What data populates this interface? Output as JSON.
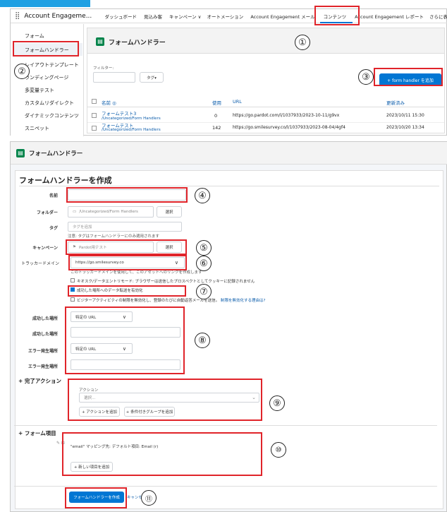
{
  "topbar": {
    "app_name": "Account Engageme...",
    "nav_items": [
      "ダッシュボード",
      "見込み客",
      "キャンペーン ∨",
      "オートメーション",
      "Account Engagement メール",
      "コンテンツ",
      "Account Engagement レポート",
      "さらに表"
    ]
  },
  "sidebar": {
    "items": [
      "フォーム",
      "フォームハンドラー",
      "レイアウトテンプレート",
      "ランディングページ",
      "多変量テスト",
      "カスタムリダイレクト",
      "ダイナミックコンテンツ",
      "スニペット"
    ]
  },
  "list_panel": {
    "title": "フォームハンドラー",
    "filter_label": "フィルター:",
    "tag_button": "タグ▾",
    "add_button": "+ form handler を追加",
    "columns": [
      "名前 ◎",
      "使用",
      "URL",
      "更新済み"
    ],
    "rows": [
      {
        "name": "フォームテスト3",
        "folder": "/Uncategorized/Form Handlers",
        "usage": "0",
        "url": "https://go.pardot.com/l/1037933/2023-10-11/g9vx",
        "updated": "2023/10/11 15:30"
      },
      {
        "name": "フォームテスト",
        "folder": "/Uncategorized/Form Handlers",
        "usage": "142",
        "url": "https://go.smilesurvey.co/l/1037933/2023-08-04/4gf4",
        "updated": "2023/10/20 13:34"
      }
    ]
  },
  "create_panel": {
    "header": "フォームハンドラー",
    "title": "フォームハンドラーを作成",
    "name_label": "名前",
    "folder_label": "フォルダー",
    "folder_value": "/Uncategorized/Form Handlers",
    "select_label": "選択",
    "tag_label": "タグ",
    "tag_placeholder": "タグを追加",
    "tag_note": "注意: タグはフォームハンドラーにのみ適用されます",
    "campaign_label": "キャンペーン",
    "campaign_value": "Pardot用テスト",
    "tracker_label": "トラッカードメイン",
    "tracker_value": "https://go.smilesurvey.co",
    "tracker_note": "このトラッカードメインを使用して、このアセットへのリンクを作成します",
    "kiosk_text": "キオスク/データエントリモード: ブラウザーは送信したプロスペクトとしてクッキーに記録されません",
    "forward_text": "成功した場所へのデータ転送を有効化",
    "visitor_text": "ビジターアクティビティの制限を無効化し、登録のたびに自動返答メールを送信。",
    "visitor_link": "制限を無効化する理由は?",
    "success_loc_label": "成功した場所",
    "success_loc_select": "特定の URL",
    "success_loc2_label": "成功した場所",
    "error_loc_label": "エラー発生場所",
    "error_loc_select": "特定の URL",
    "error_loc2_label": "エラー発生場所",
    "completion_title": "+ 完了アクション",
    "action_label": "アクション",
    "action_select": "選択...",
    "add_action": "+ アクションを追加",
    "add_condition": "+ 条件付きグループを追加",
    "form_fields_title": "+ フォーム項目",
    "mapping_text": "\"email\" マッピング先: デフォルト項目: Email (r)",
    "new_field_button": "+ 新しい項目を追加",
    "submit_button": "フォームハンドラーを作成",
    "cancel_text": "キャンセル"
  },
  "annotations": [
    "①",
    "②",
    "③",
    "④",
    "⑤",
    "⑥",
    "⑦",
    "⑧",
    "⑨",
    "⑩",
    "⑪"
  ],
  "colors": {
    "accent": "#0176d3",
    "annotation": "#e0242a",
    "brand_icon": "#04844b",
    "tab_highlight": "#2fa3e6"
  }
}
